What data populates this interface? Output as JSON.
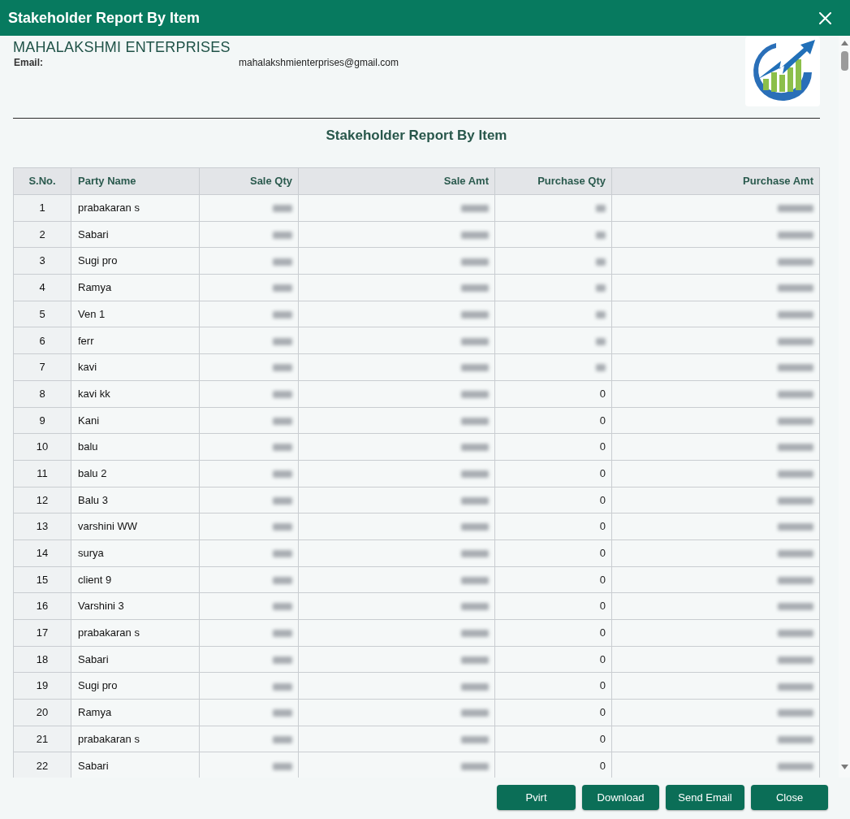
{
  "window": {
    "title": "Stakeholder Report By Item"
  },
  "company": {
    "name": "MAHALAKSHMI ENTERPRISES",
    "email_label": "Email:",
    "email": "mahalakshmienterprises@gmail.com"
  },
  "report_title": "Stakeholder Report By Item",
  "table": {
    "columns": [
      "S.No.",
      "Party Name",
      "Sale Qty",
      "Sale Amt",
      "Purchase Qty",
      "Purchase Amt"
    ],
    "rows": [
      {
        "sno": "1",
        "party_name": "prabakaran s",
        "sale_qty": {
          "blurred": true
        },
        "sale_amt": {
          "blurred": true
        },
        "purchase_qty": {
          "blurred": true
        },
        "purchase_amt": {
          "blurred": true
        }
      },
      {
        "sno": "2",
        "party_name": "Sabari",
        "sale_qty": {
          "blurred": true
        },
        "sale_amt": {
          "blurred": true
        },
        "purchase_qty": {
          "blurred": true
        },
        "purchase_amt": {
          "blurred": true
        }
      },
      {
        "sno": "3",
        "party_name": "Sugi pro",
        "sale_qty": {
          "blurred": true
        },
        "sale_amt": {
          "blurred": true
        },
        "purchase_qty": {
          "blurred": true
        },
        "purchase_amt": {
          "blurred": true
        }
      },
      {
        "sno": "4",
        "party_name": "Ramya",
        "sale_qty": {
          "blurred": true
        },
        "sale_amt": {
          "blurred": true
        },
        "purchase_qty": {
          "blurred": true
        },
        "purchase_amt": {
          "blurred": true
        }
      },
      {
        "sno": "5",
        "party_name": "Ven 1",
        "sale_qty": {
          "blurred": true
        },
        "sale_amt": {
          "blurred": true
        },
        "purchase_qty": {
          "blurred": true
        },
        "purchase_amt": {
          "blurred": true
        }
      },
      {
        "sno": "6",
        "party_name": "ferr",
        "sale_qty": {
          "blurred": true
        },
        "sale_amt": {
          "blurred": true
        },
        "purchase_qty": {
          "blurred": true
        },
        "purchase_amt": {
          "blurred": true
        }
      },
      {
        "sno": "7",
        "party_name": "kavi",
        "sale_qty": {
          "blurred": true
        },
        "sale_amt": {
          "blurred": true
        },
        "purchase_qty": {
          "blurred": true
        },
        "purchase_amt": {
          "blurred": true
        }
      },
      {
        "sno": "8",
        "party_name": "kavi kk",
        "sale_qty": {
          "blurred": true
        },
        "sale_amt": {
          "blurred": true
        },
        "purchase_qty": {
          "blurred": false,
          "text": "0"
        },
        "purchase_amt": {
          "blurred": true
        }
      },
      {
        "sno": "9",
        "party_name": "Kani",
        "sale_qty": {
          "blurred": true
        },
        "sale_amt": {
          "blurred": true
        },
        "purchase_qty": {
          "blurred": false,
          "text": "0"
        },
        "purchase_amt": {
          "blurred": true
        }
      },
      {
        "sno": "10",
        "party_name": "balu",
        "sale_qty": {
          "blurred": true
        },
        "sale_amt": {
          "blurred": true
        },
        "purchase_qty": {
          "blurred": false,
          "text": "0"
        },
        "purchase_amt": {
          "blurred": true
        }
      },
      {
        "sno": "11",
        "party_name": "balu 2",
        "sale_qty": {
          "blurred": true
        },
        "sale_amt": {
          "blurred": true
        },
        "purchase_qty": {
          "blurred": false,
          "text": "0"
        },
        "purchase_amt": {
          "blurred": true
        }
      },
      {
        "sno": "12",
        "party_name": "Balu 3",
        "sale_qty": {
          "blurred": true
        },
        "sale_amt": {
          "blurred": true
        },
        "purchase_qty": {
          "blurred": false,
          "text": "0"
        },
        "purchase_amt": {
          "blurred": true
        }
      },
      {
        "sno": "13",
        "party_name": "varshini WW",
        "sale_qty": {
          "blurred": true
        },
        "sale_amt": {
          "blurred": true
        },
        "purchase_qty": {
          "blurred": false,
          "text": "0"
        },
        "purchase_amt": {
          "blurred": true
        }
      },
      {
        "sno": "14",
        "party_name": "surya",
        "sale_qty": {
          "blurred": true
        },
        "sale_amt": {
          "blurred": true
        },
        "purchase_qty": {
          "blurred": false,
          "text": "0"
        },
        "purchase_amt": {
          "blurred": true
        }
      },
      {
        "sno": "15",
        "party_name": "client 9",
        "sale_qty": {
          "blurred": true
        },
        "sale_amt": {
          "blurred": true
        },
        "purchase_qty": {
          "blurred": false,
          "text": "0"
        },
        "purchase_amt": {
          "blurred": true
        }
      },
      {
        "sno": "16",
        "party_name": "Varshini 3",
        "sale_qty": {
          "blurred": true
        },
        "sale_amt": {
          "blurred": true
        },
        "purchase_qty": {
          "blurred": false,
          "text": "0"
        },
        "purchase_amt": {
          "blurred": true
        }
      },
      {
        "sno": "17",
        "party_name": "prabakaran s",
        "sale_qty": {
          "blurred": true
        },
        "sale_amt": {
          "blurred": true
        },
        "purchase_qty": {
          "blurred": false,
          "text": "0"
        },
        "purchase_amt": {
          "blurred": true
        }
      },
      {
        "sno": "18",
        "party_name": "Sabari",
        "sale_qty": {
          "blurred": true
        },
        "sale_amt": {
          "blurred": true
        },
        "purchase_qty": {
          "blurred": false,
          "text": "0"
        },
        "purchase_amt": {
          "blurred": true
        }
      },
      {
        "sno": "19",
        "party_name": "Sugi pro",
        "sale_qty": {
          "blurred": true
        },
        "sale_amt": {
          "blurred": true
        },
        "purchase_qty": {
          "blurred": false,
          "text": "0"
        },
        "purchase_amt": {
          "blurred": true
        }
      },
      {
        "sno": "20",
        "party_name": "Ramya",
        "sale_qty": {
          "blurred": true
        },
        "sale_amt": {
          "blurred": true
        },
        "purchase_qty": {
          "blurred": false,
          "text": "0"
        },
        "purchase_amt": {
          "blurred": true
        }
      },
      {
        "sno": "21",
        "party_name": "prabakaran s",
        "sale_qty": {
          "blurred": true
        },
        "sale_amt": {
          "blurred": true
        },
        "purchase_qty": {
          "blurred": false,
          "text": "0"
        },
        "purchase_amt": {
          "blurred": true
        }
      },
      {
        "sno": "22",
        "party_name": "Sabari",
        "sale_qty": {
          "blurred": true
        },
        "sale_amt": {
          "blurred": true
        },
        "purchase_qty": {
          "blurred": false,
          "text": "0"
        },
        "purchase_amt": {
          "blurred": true
        }
      }
    ]
  },
  "buttons": [
    "Pvirt",
    "Download",
    "Send Email",
    "Close"
  ]
}
